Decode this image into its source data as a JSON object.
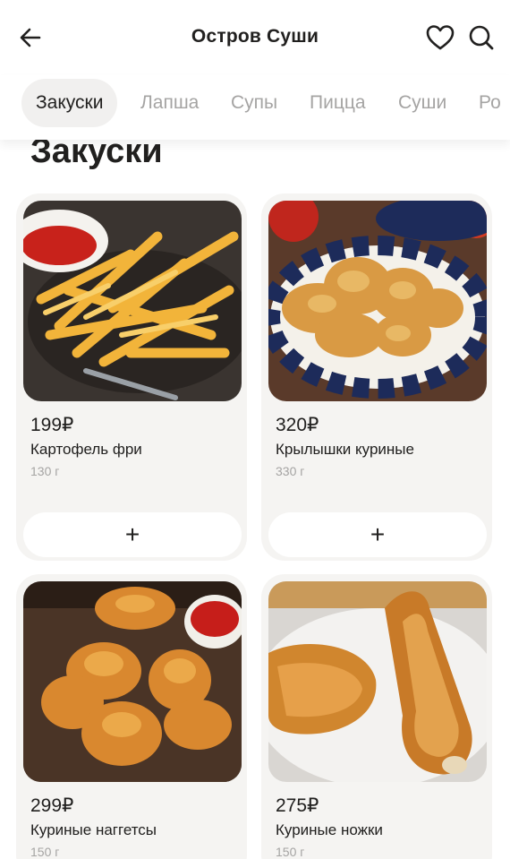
{
  "header": {
    "title": "Остров Суши",
    "back_icon": "arrow-left-icon",
    "favorite_icon": "heart-icon",
    "search_icon": "search-icon"
  },
  "tabs": [
    {
      "label": "Закуски",
      "active": true
    },
    {
      "label": "Лапша",
      "active": false
    },
    {
      "label": "Супы",
      "active": false
    },
    {
      "label": "Пицца",
      "active": false
    },
    {
      "label": "Суши",
      "active": false
    },
    {
      "label": "Ро",
      "active": false
    }
  ],
  "section": {
    "title": "Закуски"
  },
  "products": [
    {
      "price": "199₽",
      "name": "Картофель фри",
      "weight": "130 г",
      "add_label": "+"
    },
    {
      "price": "320₽",
      "name": "Крылышки куриные",
      "weight": "330 г",
      "add_label": "+"
    },
    {
      "price": "299₽",
      "name": "Куриные наггетсы",
      "weight": "150 г",
      "add_label": "+"
    },
    {
      "price": "275₽",
      "name": "Куриные ножки",
      "weight": "150 г",
      "add_label": "+"
    }
  ],
  "colors": {
    "text": "#21201f",
    "muted": "#a5a4a3",
    "card_bg": "#f5f4f2",
    "active_tab_bg": "#f1f0ef"
  }
}
